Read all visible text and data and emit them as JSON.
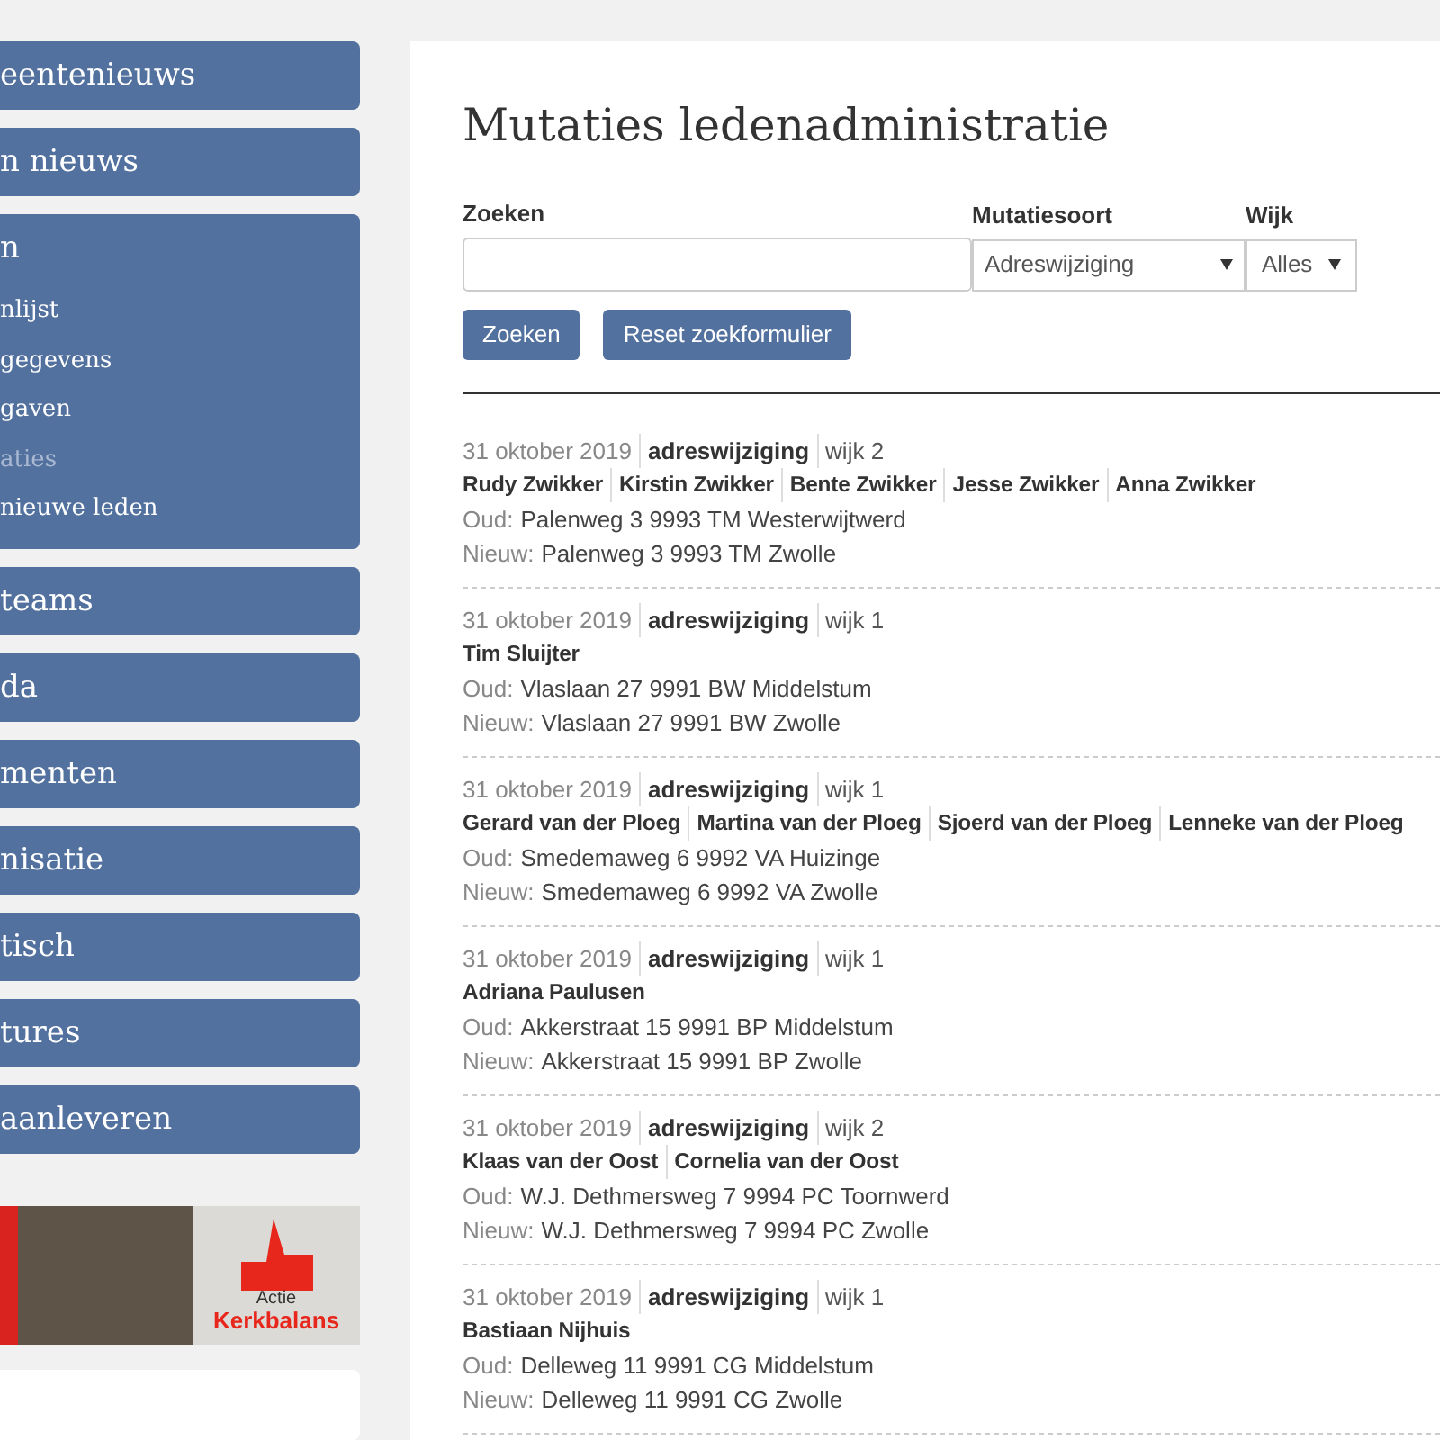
{
  "sidebar": {
    "items": [
      {
        "label": "eentenieuws"
      },
      {
        "label": "n nieuws"
      },
      {
        "label": "n",
        "expanded": true,
        "children": [
          {
            "label": "nlijst",
            "selected": false
          },
          {
            "label": "gegevens",
            "selected": false
          },
          {
            "label": "gaven",
            "selected": false
          },
          {
            "label": "aties",
            "selected": true
          },
          {
            "label": "nieuwe leden",
            "selected": false
          }
        ]
      },
      {
        "label": "teams"
      },
      {
        "label": "da"
      },
      {
        "label": "menten"
      },
      {
        "label": "nisatie"
      },
      {
        "label": "tisch"
      },
      {
        "label": "tures"
      },
      {
        "label": "aanleveren"
      }
    ],
    "banner": {
      "small_text": "Actie",
      "big_text": "Kerkbalans"
    }
  },
  "main": {
    "title": "Mutaties ledenadministratie",
    "form": {
      "search_label": "Zoeken",
      "type_label": "Mutatiesoort",
      "type_value": "Adreswijziging",
      "wijk_label": "Wijk",
      "wijk_value": "Alles",
      "buttons": [
        "Zoeken",
        "Reset zoekformulier"
      ]
    },
    "entries": [
      {
        "date": "31 oktober 2019",
        "type": "adreswijziging",
        "wijk": "wijk 2",
        "names": [
          "Rudy Zwikker",
          "Kirstin Zwikker",
          "Bente Zwikker",
          "Jesse Zwikker",
          "Anna Zwikker"
        ],
        "old_label": "Oud:",
        "old": "Palenweg 3 9993 TM Westerwijtwerd",
        "new_label": "Nieuw:",
        "new": "Palenweg 3 9993 TM Zwolle"
      },
      {
        "date": "31 oktober 2019",
        "type": "adreswijziging",
        "wijk": "wijk 1",
        "names": [
          "Tim Sluijter"
        ],
        "old_label": "Oud:",
        "old": "Vlaslaan 27 9991 BW Middelstum",
        "new_label": "Nieuw:",
        "new": "Vlaslaan 27 9991 BW Zwolle"
      },
      {
        "date": "31 oktober 2019",
        "type": "adreswijziging",
        "wijk": "wijk 1",
        "names": [
          "Gerard van der Ploeg",
          "Martina van der Ploeg",
          "Sjoerd van der Ploeg",
          "Lenneke van der Ploeg"
        ],
        "old_label": "Oud:",
        "old": "Smedemaweg 6 9992 VA Huizinge",
        "new_label": "Nieuw:",
        "new": "Smedemaweg 6 9992 VA Zwolle"
      },
      {
        "date": "31 oktober 2019",
        "type": "adreswijziging",
        "wijk": "wijk 1",
        "names": [
          "Adriana Paulusen"
        ],
        "old_label": "Oud:",
        "old": "Akkerstraat 15 9991 BP Middelstum",
        "new_label": "Nieuw:",
        "new": "Akkerstraat 15 9991 BP Zwolle"
      },
      {
        "date": "31 oktober 2019",
        "type": "adreswijziging",
        "wijk": "wijk 2",
        "names": [
          "Klaas van der Oost",
          "Cornelia van der Oost"
        ],
        "old_label": "Oud:",
        "old": "W.J. Dethmersweg 7 9994 PC Toornwerd",
        "new_label": "Nieuw:",
        "new": "W.J. Dethmersweg 7 9994 PC Zwolle"
      },
      {
        "date": "31 oktober 2019",
        "type": "adreswijziging",
        "wijk": "wijk 1",
        "names": [
          "Bastiaan Nijhuis"
        ],
        "old_label": "Oud:",
        "old": "Delleweg 11 9991 CG Middelstum",
        "new_label": "Nieuw:",
        "new": "Delleweg 11 9991 CG Zwolle"
      }
    ]
  }
}
